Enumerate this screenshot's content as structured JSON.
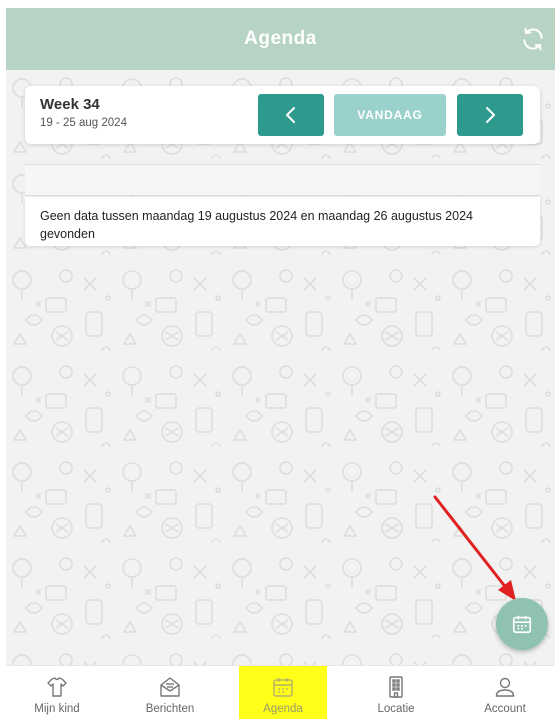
{
  "header": {
    "title": "Agenda",
    "refresh_icon": "refresh-icon"
  },
  "week": {
    "title": "Week 34",
    "range": "19 - 25 aug 2024",
    "today_label": "VANDAAG",
    "prev_icon": "chevron-left-icon",
    "next_icon": "chevron-right-icon"
  },
  "message": {
    "text": "Geen data tussen maandag 19 augustus 2024 en maandag 26 augustus 2024 gevonden"
  },
  "fab": {
    "icon": "calendar-icon"
  },
  "bottom_nav": {
    "items": [
      {
        "label": "Mijn kind",
        "icon": "child-shirt-icon"
      },
      {
        "label": "Berichten",
        "icon": "envelope-icon"
      },
      {
        "label": "Agenda",
        "icon": "calendar-icon",
        "active": true
      },
      {
        "label": "Locatie",
        "icon": "building-icon"
      },
      {
        "label": "Account",
        "icon": "user-icon"
      }
    ]
  },
  "colors": {
    "header": "#b7d3c4",
    "primary": "#2e9a8e",
    "today_button": "#9ad1cc",
    "fab": "#8fc2b1",
    "highlight": "#ffff1a",
    "annotation_arrow": "#e02020",
    "background": "#f1f2f1"
  }
}
